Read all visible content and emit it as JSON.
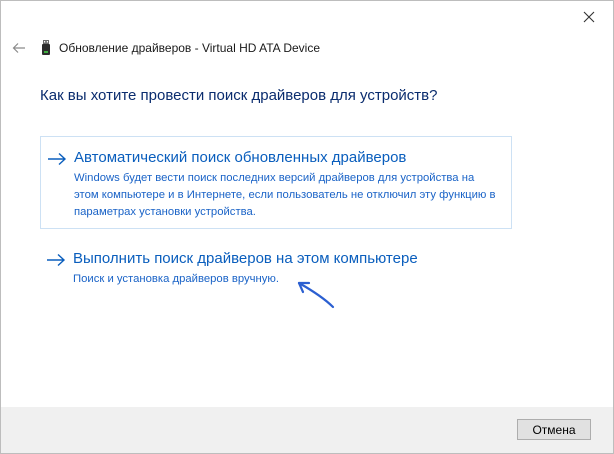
{
  "window": {
    "title": "Обновление драйверов - Virtual HD ATA Device",
    "back_icon": "back-arrow-icon",
    "device_icon": "usb-device-icon",
    "close_icon": "close-icon"
  },
  "question": "Как вы хотите провести поиск драйверов для устройств?",
  "options": [
    {
      "title": "Автоматический поиск обновленных драйверов",
      "description": "Windows будет вести поиск последних версий драйверов для устройства на этом компьютере и в Интернете, если пользователь не отключил эту функцию в параметрах установки устройства.",
      "icon": "right-arrow-icon"
    },
    {
      "title": "Выполнить поиск драйверов на этом компьютере",
      "description": "Поиск и установка драйверов вручную.",
      "icon": "right-arrow-icon"
    }
  ],
  "footer": {
    "cancel_label": "Отмена"
  },
  "colors": {
    "link": "#0a5ebd",
    "heading": "#0a2c6e",
    "annotation_arrow": "#2b5fd1",
    "footer_bg": "#f0f0f0"
  }
}
